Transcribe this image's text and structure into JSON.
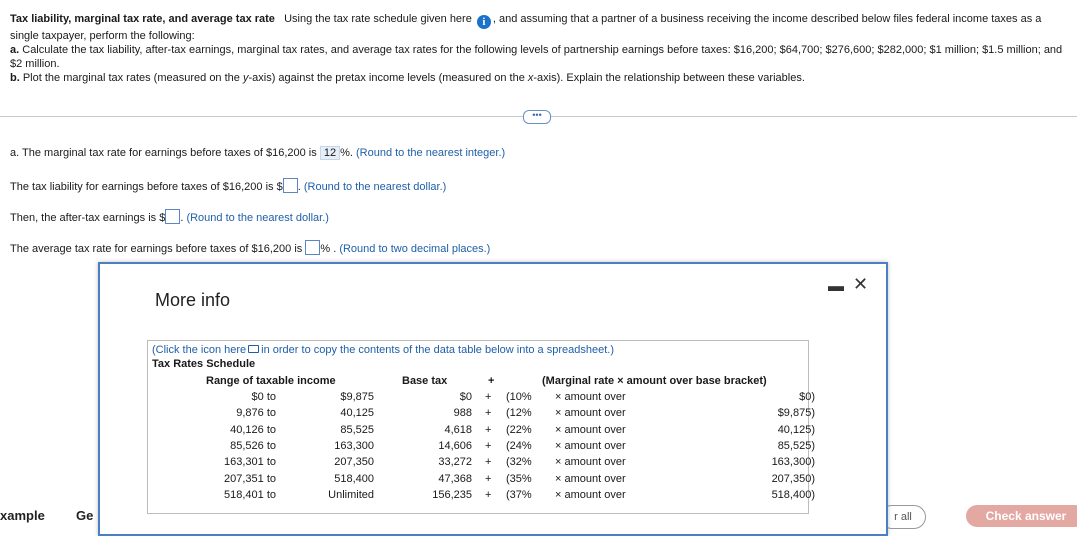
{
  "problem": {
    "title": "Tax liability, marginal tax rate, and average tax rate",
    "intro1": "Using the tax rate schedule given here",
    "intro2": ", and assuming that a partner of a business receiving the income described below files federal income taxes as a single taxpayer, perform the following:",
    "part_a_label": "a.",
    "part_a": "Calculate the tax liability, after-tax earnings, marginal tax rates, and average tax rates for the following levels of partnership earnings before taxes: $16,200; $64,700; $276,600; $282,000; $1 million; $1.5 million; and $2 million.",
    "part_b_label": "b.",
    "part_b_1": "Plot the marginal tax rates (measured on the ",
    "part_b_y": "y",
    "part_b_2": "-axis) against the pretax income levels (measured on the ",
    "part_b_x": "x",
    "part_b_3": "-axis). Explain the relationship between these variables."
  },
  "questions": {
    "q1_pre": "a. The marginal tax rate for earnings before taxes of $16,200 is",
    "q1_value": "12",
    "q1_post": "%.",
    "q1_hint": "(Round to the nearest integer.)",
    "q2_pre": "The tax liability for earnings before taxes of $16,200 is $",
    "q2_hint": "(Round to the nearest dollar.)",
    "q3_pre": "Then, the after-tax earnings is $",
    "q3_hint": "(Round to the nearest dollar.)",
    "q4_pre": "The average tax rate for earnings before taxes of $16,200 is",
    "q4_post": "% .",
    "q4_hint": "(Round to two decimal places.)"
  },
  "modal": {
    "title": "More info",
    "copy_note_1": "(Click the icon here",
    "copy_note_2": "in order to copy the contents of the data table below into a spreadsheet.)",
    "table_title": "Tax Rates Schedule",
    "headers": {
      "range": "Range of taxable income",
      "base": "Base tax",
      "plus": "+",
      "marginal": "(Marginal rate × amount over base bracket)"
    },
    "rows": [
      {
        "from": "$0 to",
        "to": "$9,875",
        "base": "$0",
        "plus": "+",
        "rate": "(10%",
        "amt": "× amount over",
        "over": "$0)"
      },
      {
        "from": "9,876 to",
        "to": "40,125",
        "base": "988",
        "plus": "+",
        "rate": "(12%",
        "amt": "× amount over",
        "over": "$9,875)"
      },
      {
        "from": "40,126 to",
        "to": "85,525",
        "base": "4,618",
        "plus": "+",
        "rate": "(22%",
        "amt": "× amount over",
        "over": "40,125)"
      },
      {
        "from": "85,526 to",
        "to": "163,300",
        "base": "14,606",
        "plus": "+",
        "rate": "(24%",
        "amt": "× amount over",
        "over": "85,525)"
      },
      {
        "from": "163,301 to",
        "to": "207,350",
        "base": "33,272",
        "plus": "+",
        "rate": "(32%",
        "amt": "× amount over",
        "over": "163,300)"
      },
      {
        "from": "207,351 to",
        "to": "518,400",
        "base": "47,368",
        "plus": "+",
        "rate": "(35%",
        "amt": "× amount over",
        "over": "207,350)"
      },
      {
        "from": "518,401 to",
        "to": "Unlimited",
        "base": "156,235",
        "plus": "+",
        "rate": "(37%",
        "amt": "× amount over",
        "over": "518,400)"
      }
    ]
  },
  "footer": {
    "left1": "xample",
    "left2": "Ge",
    "clear_all": "r all",
    "check_answer": "Check answer"
  }
}
